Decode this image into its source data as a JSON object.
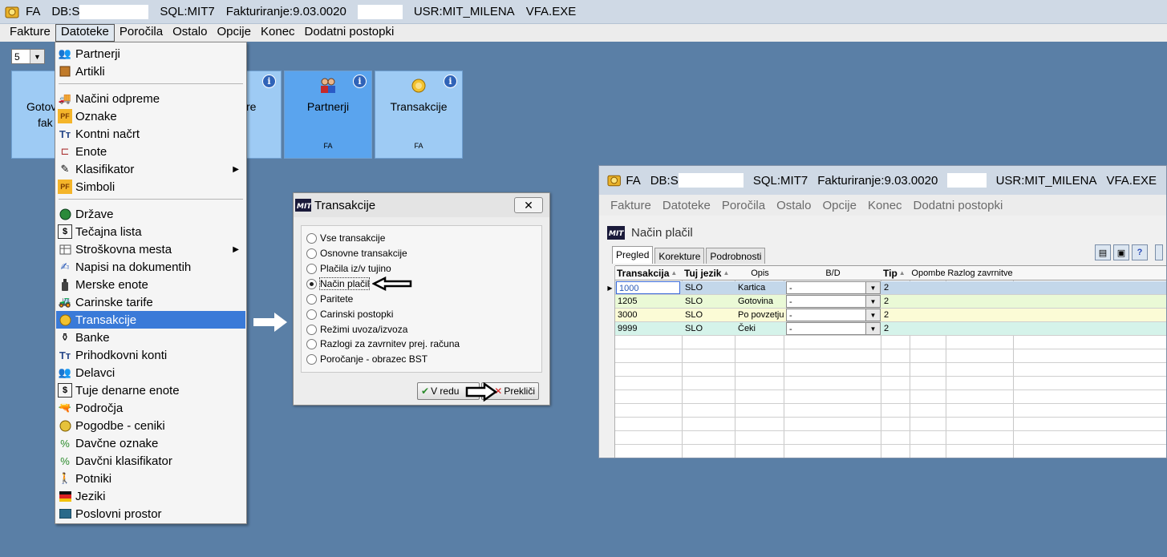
{
  "main_title": {
    "app": "FA",
    "db": "DB:S",
    "sql": "SQL:MIT7",
    "fakt": "Fakturiranje:9.03.0020",
    "usr": "USR:MIT_MILENA",
    "exe": "VFA.EXE"
  },
  "main_menu": [
    "Fakture",
    "Datoteke",
    "Poročila",
    "Ostalo",
    "Opcije",
    "Konec",
    "Dodatni postopki"
  ],
  "page_size": "5",
  "tiles": [
    {
      "label": "Gotov",
      "label2": "fak"
    },
    {
      "label": "re"
    },
    {
      "label": "Partnerji",
      "sub": "FA"
    },
    {
      "label": "Transakcije",
      "sub": "FA"
    }
  ],
  "tile_info": "i",
  "dropdown_items": [
    {
      "label": "Partnerji",
      "icon": "people-icon"
    },
    {
      "label": "Artikli",
      "icon": "box-icon"
    },
    {
      "label": "Načini odpreme",
      "icon": "truck-icon"
    },
    {
      "label": "Oznake",
      "icon": "pf-icon"
    },
    {
      "label": "Kontni načrt",
      "icon": "tt-icon"
    },
    {
      "label": "Enote",
      "icon": "tree-icon"
    },
    {
      "label": "Klasifikator",
      "icon": "pen-icon",
      "submenu": true
    },
    {
      "label": "Simboli",
      "icon": "pf-icon"
    },
    {
      "label": "Države",
      "icon": "globe-icon"
    },
    {
      "label": "Tečajna lista",
      "icon": "dollar-icon"
    },
    {
      "label": "Stroškovna mesta",
      "icon": "table-icon",
      "submenu": true
    },
    {
      "label": "Napisi na dokumentih",
      "icon": "write-icon"
    },
    {
      "label": "Merske enote",
      "icon": "bottle-icon"
    },
    {
      "label": "Carinske tarife",
      "icon": "customs-icon"
    },
    {
      "label": "Transakcije",
      "icon": "coins-icon",
      "highlight": true
    },
    {
      "label": "Banke",
      "icon": "bank-icon"
    },
    {
      "label": "Prihodkovni konti",
      "icon": "tt-icon"
    },
    {
      "label": "Delavci",
      "icon": "workers-icon"
    },
    {
      "label": "Tuje denarne enote",
      "icon": "dollar-icon"
    },
    {
      "label": "Področja",
      "icon": "gun-icon"
    },
    {
      "label": "Pogodbe - ceniki",
      "icon": "contract-icon"
    },
    {
      "label": "Davčne oznake",
      "icon": "tax-icon"
    },
    {
      "label": "Davčni klasifikator",
      "icon": "tax-icon"
    },
    {
      "label": "Potniki",
      "icon": "person-icon"
    },
    {
      "label": "Jeziki",
      "icon": "flag-icon"
    },
    {
      "label": "Poslovni prostor",
      "icon": "screen-icon"
    }
  ],
  "dialog": {
    "title": "Transakcije",
    "close": "✕",
    "options": [
      "Vse transakcije",
      "Osnovne transakcije",
      "Plačila iz/v tujino",
      "Način plačil",
      "Paritete",
      "Carinski postopki",
      "Režimi uvoza/izvoza",
      "Razlogi za zavrnitev prej. računa",
      "Poročanje - obrazec BST"
    ],
    "selected_index": 3,
    "ok_label": "V redu",
    "cancel_label": "Prekliči"
  },
  "win2": {
    "title": {
      "app": "FA",
      "db": "DB:S",
      "sql": "SQL:MIT7",
      "fakt": "Fakturiranje:9.03.0020",
      "usr": "USR:MIT_MILENA",
      "exe": "VFA.EXE"
    },
    "menu": [
      "Fakture",
      "Datoteke",
      "Poročila",
      "Ostalo",
      "Opcije",
      "Konec",
      "Dodatni postopki"
    ],
    "subtitle": "Način plačil",
    "tabs": [
      "Pregled",
      "Korekture",
      "Podrobnosti"
    ],
    "columns": [
      "Transakcija",
      "Tuj jezik",
      "Opis",
      "B/D",
      "Tip",
      "Opombe",
      "Razlog zavrnitve"
    ],
    "rows": [
      {
        "transakcija": "1000",
        "jezik": "SLO",
        "opis": "Kartica",
        "bd": "-",
        "tip": "2"
      },
      {
        "transakcija": "1205",
        "jezik": "SLO",
        "opis": "Gotovina",
        "bd": "-",
        "tip": "2"
      },
      {
        "transakcija": "3000",
        "jezik": "SLO",
        "opis": "Po povzetju",
        "bd": "-",
        "tip": "2"
      },
      {
        "transakcija": "9999",
        "jezik": "SLO",
        "opis": "Čeki",
        "bd": "-",
        "tip": "2"
      }
    ]
  }
}
